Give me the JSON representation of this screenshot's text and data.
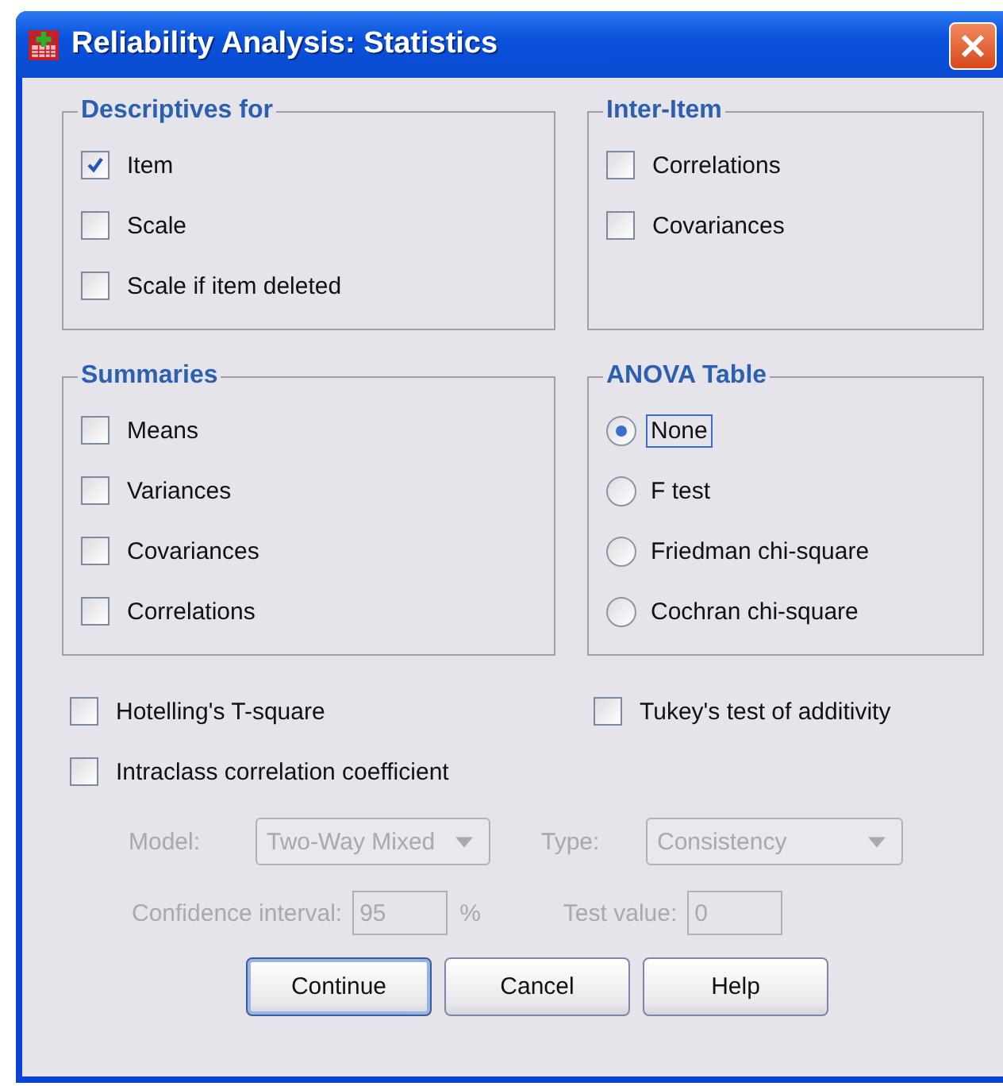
{
  "window": {
    "title": "Reliability Analysis: Statistics"
  },
  "groups": [
    {
      "title": "Descriptives for",
      "items": [
        {
          "kind": "checkbox",
          "label": "Item",
          "checked": true
        },
        {
          "kind": "checkbox",
          "label": "Scale",
          "checked": false
        },
        {
          "kind": "checkbox",
          "label": "Scale if item deleted",
          "checked": false
        }
      ]
    },
    {
      "title": "Inter-Item",
      "items": [
        {
          "kind": "checkbox",
          "label": "Correlations",
          "checked": false
        },
        {
          "kind": "checkbox",
          "label": "Covariances",
          "checked": false
        }
      ]
    },
    {
      "title": "Summaries",
      "items": [
        {
          "kind": "checkbox",
          "label": "Means",
          "checked": false
        },
        {
          "kind": "checkbox",
          "label": "Variances",
          "checked": false
        },
        {
          "kind": "checkbox",
          "label": "Covariances",
          "checked": false
        },
        {
          "kind": "checkbox",
          "label": "Correlations",
          "checked": false
        }
      ]
    },
    {
      "title": "ANOVA Table",
      "items": [
        {
          "kind": "radio",
          "label": "None",
          "selected": true
        },
        {
          "kind": "radio",
          "label": "F test",
          "selected": false
        },
        {
          "kind": "radio",
          "label": "Friedman chi-square",
          "selected": false
        },
        {
          "kind": "radio",
          "label": "Cochran chi-square",
          "selected": false
        }
      ]
    }
  ],
  "options": [
    {
      "label": "Hotelling's T-square",
      "checked": false
    },
    {
      "label": "Tukey's test of additivity",
      "checked": false
    },
    {
      "label": "Intraclass correlation coefficient",
      "checked": false
    }
  ],
  "icc": {
    "model": {
      "label": "Model:",
      "value": "Two-Way Mixed",
      "disabled": true
    },
    "type": {
      "label": "Type:",
      "value": "Consistency",
      "disabled": true
    },
    "confidence": {
      "label": "Confidence interval:",
      "value": "95",
      "unit": "%",
      "disabled": true
    },
    "test_value": {
      "label": "Test value:",
      "value": "0",
      "disabled": true
    }
  },
  "buttons": [
    {
      "label": "Continue",
      "default": true
    },
    {
      "label": "Cancel",
      "default": false
    },
    {
      "label": "Help",
      "default": false
    }
  ]
}
